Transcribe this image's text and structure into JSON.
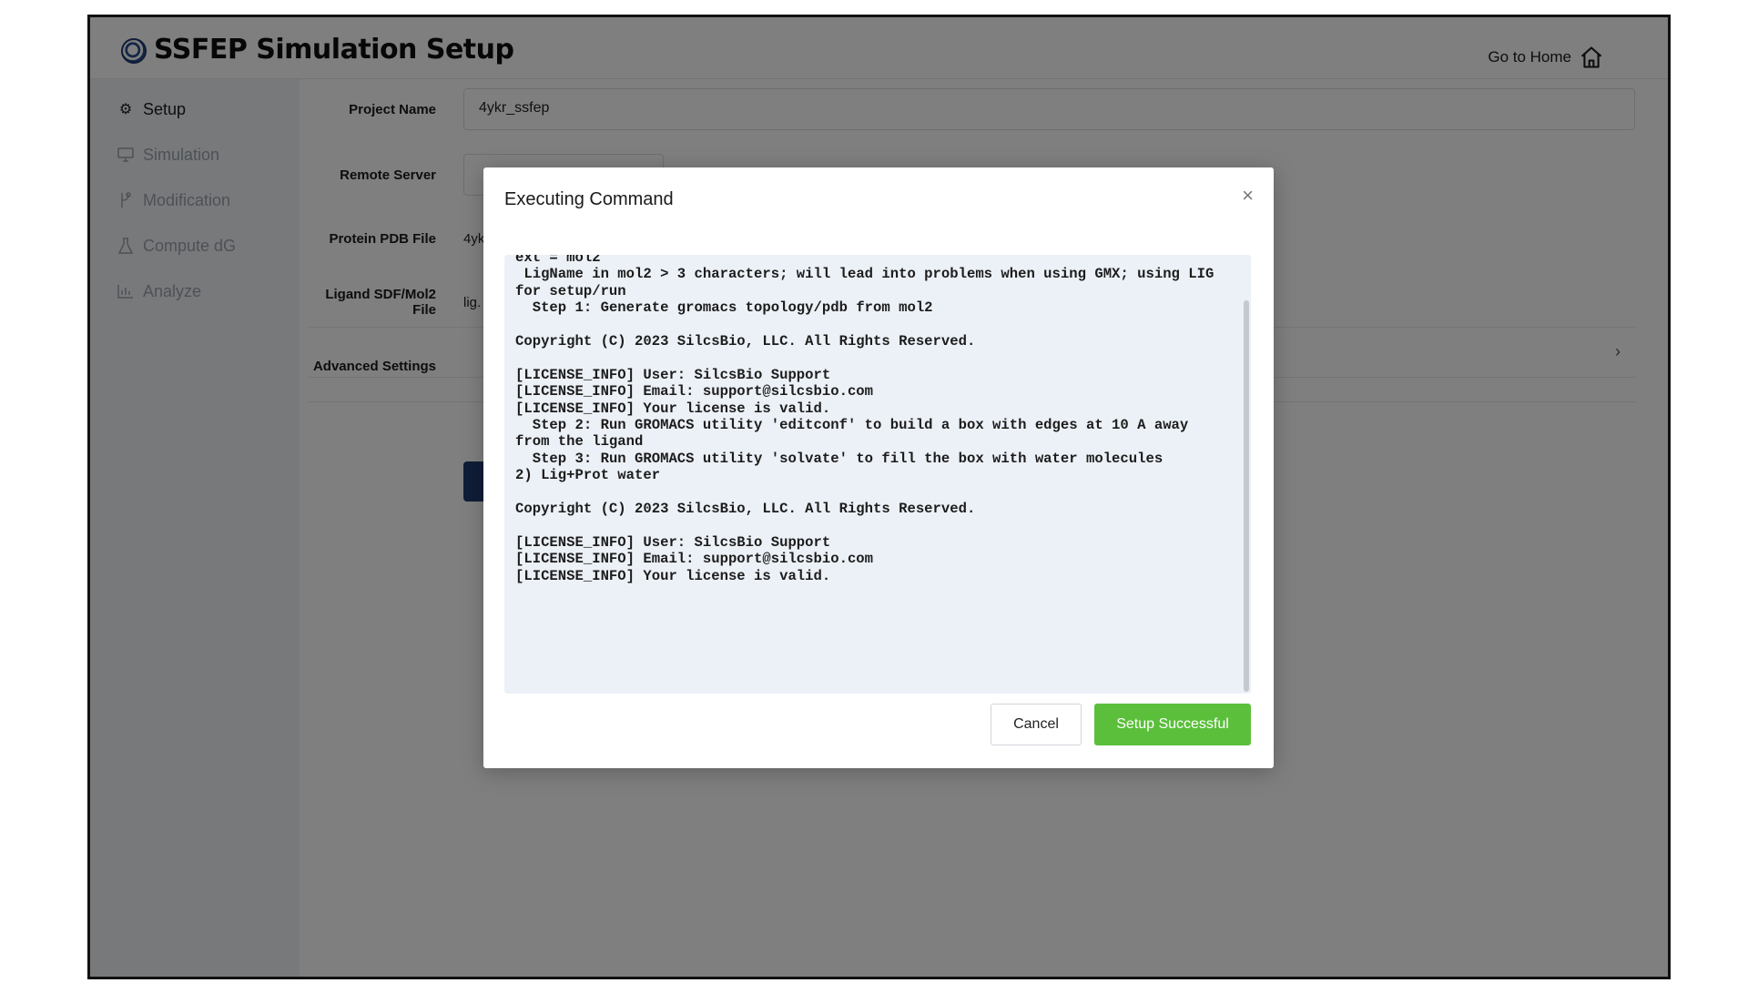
{
  "header": {
    "title": "SSFEP Simulation Setup",
    "home_link": "Go to Home"
  },
  "sidebar": {
    "items": [
      {
        "label": "Setup",
        "icon": "gear-icon",
        "active": true
      },
      {
        "label": "Simulation",
        "icon": "monitor-icon",
        "active": false
      },
      {
        "label": "Modification",
        "icon": "branch-icon",
        "active": false
      },
      {
        "label": "Compute dG",
        "icon": "flask-icon",
        "active": false
      },
      {
        "label": "Analyze",
        "icon": "bar-chart-icon",
        "active": false
      }
    ]
  },
  "form": {
    "project_name_label": "Project Name",
    "project_name_value": "4ykr_ssfep",
    "remote_server_label": "Remote Server",
    "protein_pdb_label": "Protein PDB File",
    "protein_pdb_value": "4yk",
    "ligand_label": "Ligand SDF/Mol2 File",
    "ligand_value": "lig.",
    "advanced_label": "Advanced Settings"
  },
  "modal": {
    "title": "Executing Command",
    "close_icon": "close-icon",
    "output": "ext = mol2\n LigName in mol2 > 3 characters; will lead into problems when using GMX; using LIG for setup/run\n  Step 1: Generate gromacs topology/pdb from mol2\n\nCopyright (C) 2023 SilcsBio, LLC. All Rights Reserved.\n\n[LICENSE_INFO] User: SilcsBio Support\n[LICENSE_INFO] Email: support@silcsbio.com\n[LICENSE_INFO] Your license is valid.\n  Step 2: Run GROMACS utility 'editconf' to build a box with edges at 10 A away from the ligand\n  Step 3: Run GROMACS utility 'solvate' to fill the box with water molecules\n2) Lig+Prot water\n\nCopyright (C) 2023 SilcsBio, LLC. All Rights Reserved.\n\n[LICENSE_INFO] User: SilcsBio Support\n[LICENSE_INFO] Email: support@silcsbio.com\n[LICENSE_INFO] Your license is valid.",
    "cancel_label": "Cancel",
    "success_label": "Setup Successful",
    "success_color": "#5bbf3b"
  }
}
